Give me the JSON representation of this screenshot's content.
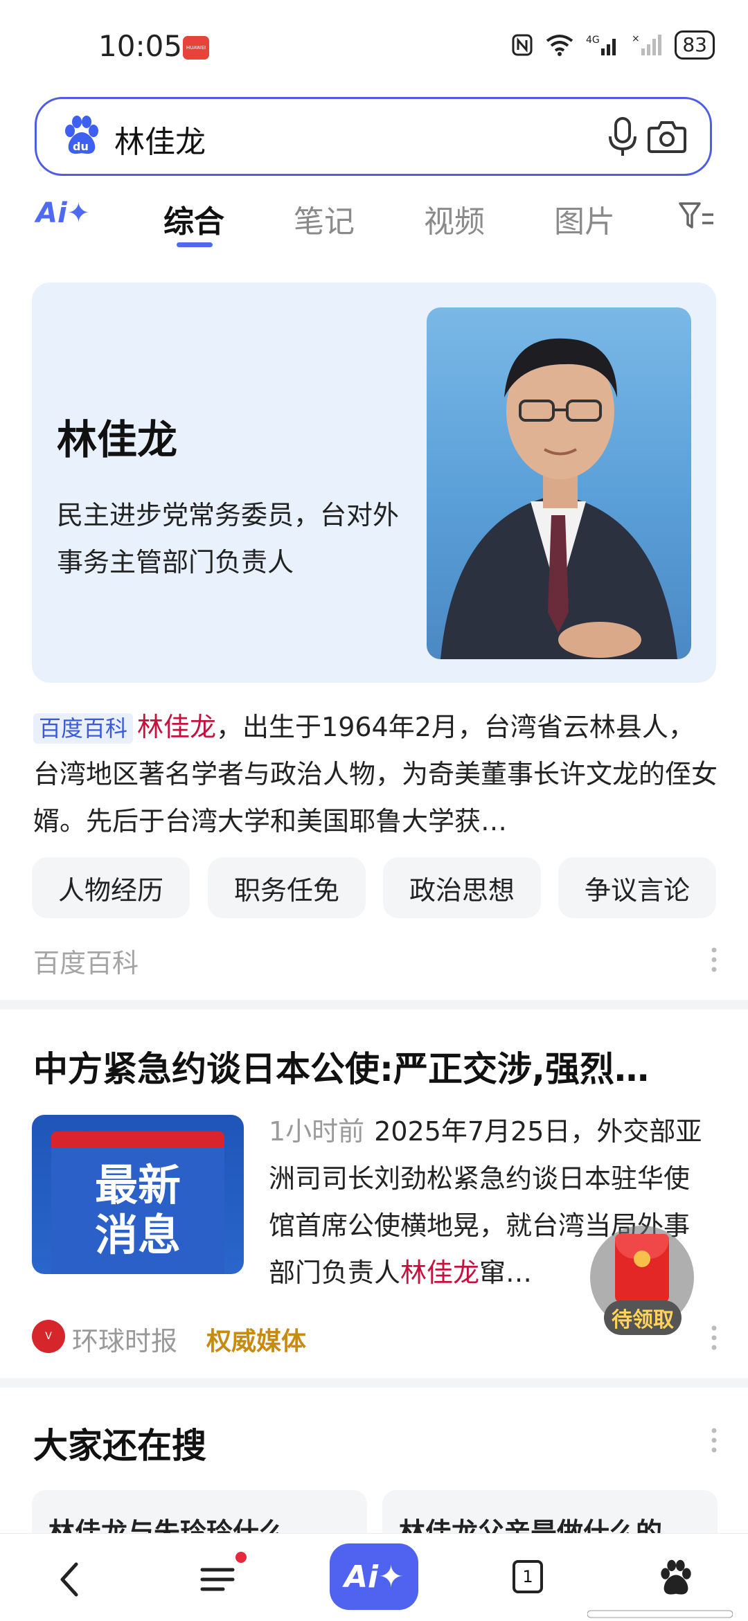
{
  "status_bar": {
    "time": "10:05",
    "huawei_badge": "HUAWEI",
    "battery": "83"
  },
  "search": {
    "query": "林佳龙"
  },
  "tabs": {
    "ai_label": "Ai✦",
    "items": [
      {
        "label": "综合",
        "active": true
      },
      {
        "label": "笔记",
        "active": false
      },
      {
        "label": "视频",
        "active": false
      },
      {
        "label": "图片",
        "active": false
      }
    ]
  },
  "hero": {
    "name": "林佳龙",
    "description": "民主进步党常务委员，台对外事务主管部门负责人"
  },
  "baike": {
    "badge": "百度百科",
    "name_highlight": "林佳龙",
    "text": "，出生于1964年2月，台湾省云林县人，台湾地区著名学者与政治人物，为奇美董事长许文龙的侄女婿。先后于台湾大学和美国耶鲁大学获…",
    "chips": [
      "人物经历",
      "职务任免",
      "政治思想",
      "争议言论"
    ],
    "source": "百度百科"
  },
  "news": {
    "title": "中方紧急约谈日本公使:严正交涉,强烈…",
    "thumb_text_line1": "最新",
    "thumb_text_line2": "消息",
    "time": "1小时前",
    "body_before": "2025年7月25日，外交部亚洲司司长刘劲松紧急约谈日本驻华使馆首席公使横地晃，就台湾当局外事部门负责人",
    "body_highlight": "林佳龙",
    "body_after": "窜…",
    "source_name": "环球时报",
    "authority_label": "权威媒体"
  },
  "red_packet": {
    "label": "待领取"
  },
  "also_searched": {
    "title": "大家还在搜",
    "items": [
      "林佳龙与朱玲玲什么",
      "林佳龙父亲是做什么的"
    ]
  },
  "bottom_nav": {
    "ai_label": "Ai✦",
    "tab_count": "1"
  },
  "colors": {
    "accent": "#4e5de4",
    "highlight": "#c4123f",
    "authority": "#c78a12",
    "hero_bg": "#e8f1fc"
  }
}
